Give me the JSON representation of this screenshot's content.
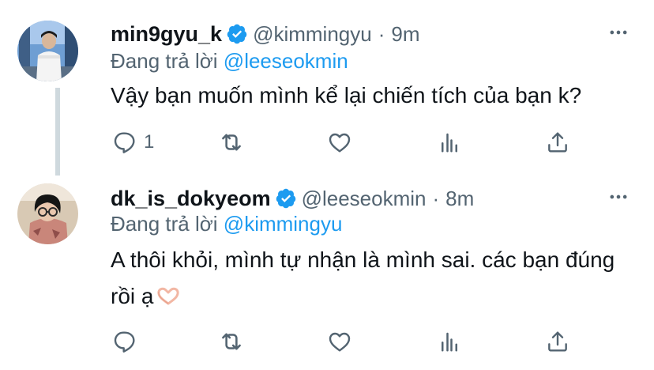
{
  "tweets": [
    {
      "display_name": "min9gyu_k",
      "handle": "@kimmingyu",
      "separator": "·",
      "time": "9m",
      "reply_prefix": "Đang trả lời",
      "reply_to": "@leeseokmin",
      "text": "Vậy bạn muốn mình kể lại chiến tích của bạn k?",
      "reply_count": "1",
      "verified": true
    },
    {
      "display_name": "dk_is_dokyeom",
      "handle": "@leeseokmin",
      "separator": "·",
      "time": "8m",
      "reply_prefix": "Đang trả lời",
      "reply_to": "@kimmingyu",
      "text": "A thôi khỏi, mình tự nhận là mình sai. các bạn đúng rồi ạ",
      "reply_count": "",
      "verified": true
    }
  ],
  "icons": {
    "verified": "verified-badge-icon",
    "more": "more-options-icon",
    "reply": "reply-icon",
    "retweet": "retweet-icon",
    "like": "like-icon",
    "analytics": "analytics-icon",
    "share": "share-icon",
    "emoji": "heart-hands-emoji"
  },
  "colors": {
    "text": "#0f1419",
    "secondary": "#536471",
    "accent": "#1d9bf0",
    "thread_line": "#cfd9de"
  }
}
